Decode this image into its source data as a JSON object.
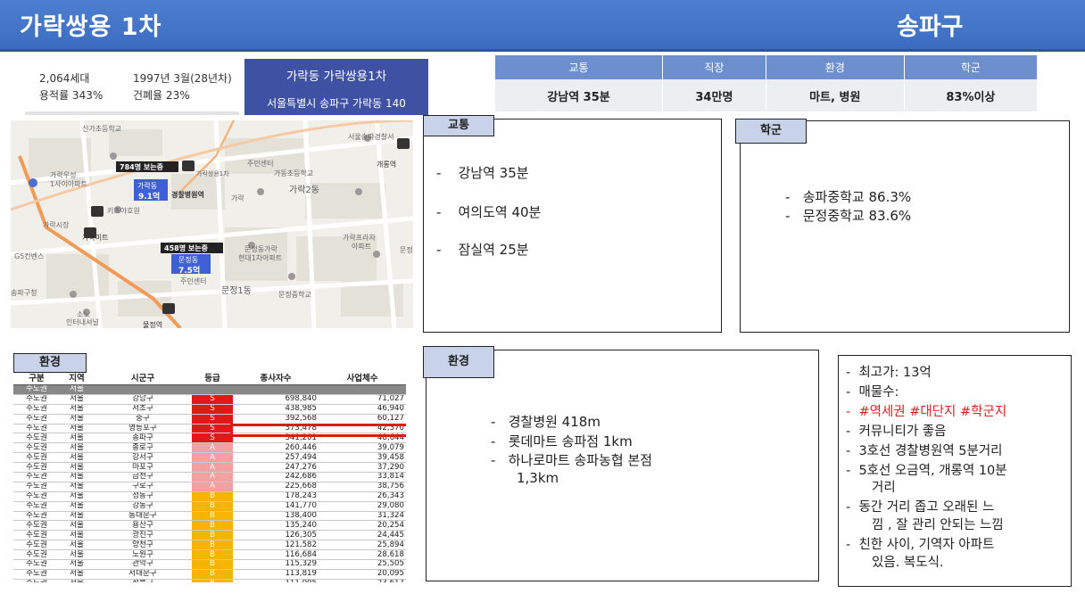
{
  "header": {
    "title": "가락쌍용 1차",
    "district": "송파구"
  },
  "info": {
    "households": "2,064세대",
    "built": "1997년 3월(28년차)",
    "far": "용적률 343%",
    "bcr": "건폐율 23%",
    "apt_name": "가락동 가락쌍용1차",
    "address": "서울특별시 송파구 가락동 140"
  },
  "summary": {
    "headers": [
      "교통",
      "직장",
      "환경",
      "학군"
    ],
    "values": [
      "강남역 35분",
      "34만명",
      "마트, 병원",
      "83%이상"
    ]
  },
  "map": {
    "labels": [
      "신가초등학교",
      "서울송파경찰서",
      "784명 보는중",
      "가락동",
      "9.1억",
      "경찰병원역",
      "가락우성",
      "1사이아파트",
      "가락쌍용1차",
      "주민센터",
      "가동초등학교",
      "가락2동",
      "가락",
      "가락시장",
      "키즈야호원",
      "가락미트",
      "G5컨벤스",
      "가락프라자",
      "아파트",
      "문정동가락",
      "현대1차아파트",
      "458명 보는중",
      "문정동",
      "7.5억",
      "주민센터",
      "물정역",
      "문정1동",
      "송파구청",
      "문정중학교",
      "소노",
      "인터내셔널",
      "개롱역",
      "문정"
    ]
  },
  "traffic": {
    "tag": "교통",
    "items": [
      "강남역 35분",
      "여의도역 40분",
      "잠실역 25분"
    ]
  },
  "school": {
    "tag": "학군",
    "items": [
      "송파중학교 86.3%",
      "문정중학교 83.6%"
    ]
  },
  "env_table": {
    "tag": "환경",
    "headers": [
      "구분",
      "지역",
      "시군구",
      "등급",
      "종사자수",
      "사업체수"
    ],
    "rows": [
      [
        "수도권",
        "서울",
        "",
        "",
        "",
        ""
      ],
      [
        "수도권",
        "서울",
        "강남구",
        "S",
        "698,840",
        "71,027"
      ],
      [
        "수도권",
        "서울",
        "서초구",
        "S",
        "438,985",
        "46,940"
      ],
      [
        "수도권",
        "서울",
        "중구",
        "S",
        "392,568",
        "60,127"
      ],
      [
        "수도권",
        "서울",
        "영등포구",
        "S",
        "373,478",
        "42,370"
      ],
      [
        "수도권",
        "서울",
        "송파구",
        "S",
        "341,201",
        "48,644"
      ],
      [
        "수도권",
        "서울",
        "종로구",
        "A",
        "260,446",
        "39,079"
      ],
      [
        "수도권",
        "서울",
        "강서구",
        "A",
        "257,494",
        "39,458"
      ],
      [
        "수도권",
        "서울",
        "마포구",
        "A",
        "247,276",
        "37,290"
      ],
      [
        "수도권",
        "서울",
        "금천구",
        "A",
        "242,686",
        "33,814"
      ],
      [
        "수도권",
        "서울",
        "구로구",
        "A",
        "225,668",
        "38,756"
      ],
      [
        "수도권",
        "서울",
        "성동구",
        "B",
        "178,243",
        "26,343"
      ],
      [
        "수도권",
        "서울",
        "강동구",
        "B",
        "141,770",
        "29,080"
      ],
      [
        "수도권",
        "서울",
        "동대문구",
        "B",
        "138,400",
        "31,324"
      ],
      [
        "수도권",
        "서울",
        "용산구",
        "B",
        "135,240",
        "20,254"
      ],
      [
        "수도권",
        "서울",
        "광진구",
        "B",
        "126,305",
        "24,445"
      ],
      [
        "수도권",
        "서울",
        "양천구",
        "B",
        "121,582",
        "25,894"
      ],
      [
        "수도권",
        "서울",
        "노원구",
        "B",
        "116,684",
        "28,618"
      ],
      [
        "수도권",
        "서울",
        "관악구",
        "B",
        "115,329",
        "25,505"
      ],
      [
        "수도권",
        "서울",
        "서대문구",
        "B",
        "113,819",
        "20,095"
      ],
      [
        "수도권",
        "서울",
        "성북구",
        "B",
        "111,005",
        "23,617"
      ],
      [
        "수도권",
        "서울",
        "동작구",
        "B",
        "106,159",
        "19,793"
      ],
      [
        "수도권",
        "서울",
        "중랑구",
        "B",
        "103,345",
        "28,228"
      ]
    ]
  },
  "env": {
    "tag": "환경",
    "items": [
      "경찰병원 418m",
      "롯데마트 송파점 1km",
      "하나로마트 송파농협 본점",
      "1,3km"
    ]
  },
  "notes": {
    "items": [
      "최고가:  13억",
      "매물수:",
      "#역세권 #대단지 #학군지",
      "커뮤니티가 좋음",
      "3호선 경찰병원역 5분거리",
      "5호선 오금역, 개롱역 10분",
      "거리",
      "동간 거리 좁고 오래된 느",
      "낌 , 잘 관리 안되는 느낌",
      "친한 사이, 기역자 아파트",
      "있음. 복도식."
    ],
    "highlight_color": "#e02020"
  }
}
